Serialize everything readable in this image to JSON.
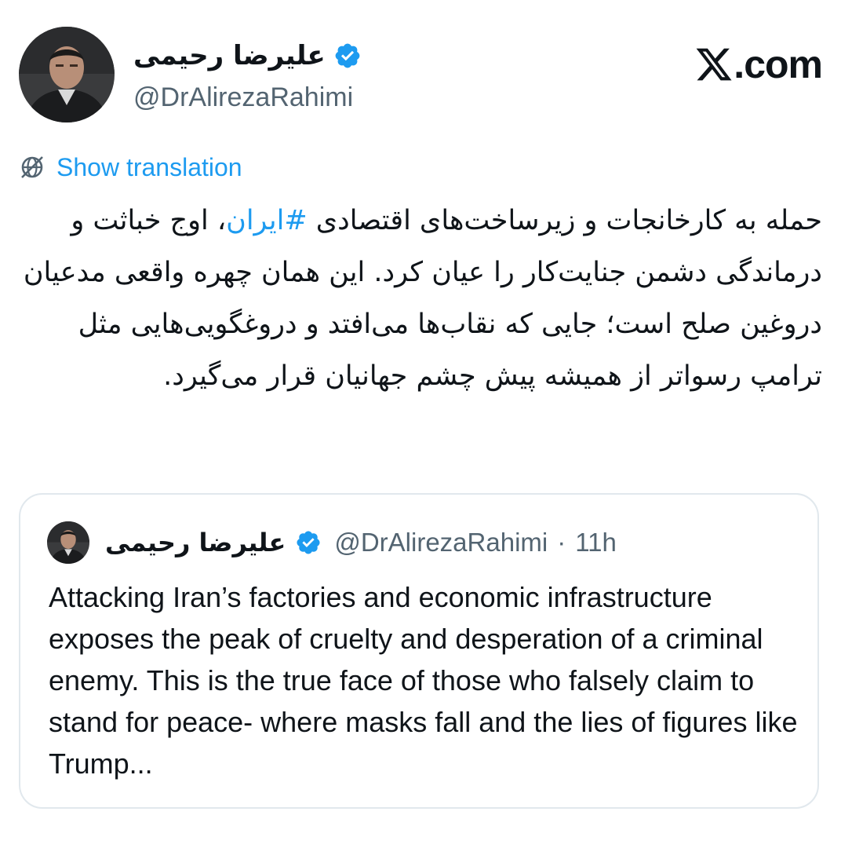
{
  "header": {
    "display_name": "علیرضا رحیمی",
    "handle": "@DrAlirezaRahimi",
    "site_logo_text": ".com",
    "site_logo_icon": "x-logo-icon"
  },
  "translation": {
    "label": "Show translation",
    "icon": "globe-icon"
  },
  "tweet": {
    "text_before_hashtag": "حمله به کارخانجات و زیرساخت‌های اقتصادی ",
    "hashtag": "#ایران",
    "text_after_hashtag": "، اوج خباثت و درماندگی دشمن جنایت‌کار را عیان کرد. این همان چهره واقعی مدعیان دروغین صلح است؛ جایی که نقاب‌ها می‌افتد و دروغگویی‌هایی مثل ترامپ رسواتر از همیشه پیش چشم جهانیان قرار می‌گیرد."
  },
  "quote": {
    "display_name": "علیرضا رحیمی",
    "handle": "@DrAlirezaRahimi",
    "separator": "·",
    "time": "11h",
    "text": "Attacking Iran’s factories and economic infrastructure exposes the peak of cruelty and desperation of a criminal enemy. This is the true face of those who falsely claim to stand for peace- where masks fall and the lies of figures like Trump..."
  },
  "colors": {
    "accent": "#1d9bf0",
    "secondary_text": "#536471",
    "primary_text": "#0f1419",
    "border": "#e1e8ed"
  }
}
